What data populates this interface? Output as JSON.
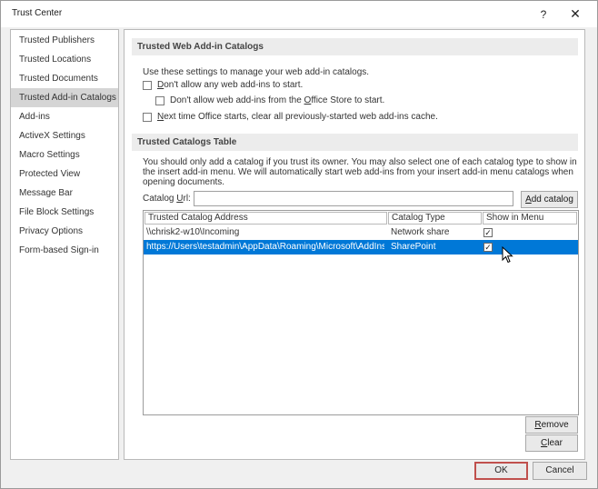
{
  "window": {
    "title": "Trust Center",
    "help_glyph": "?",
    "close_glyph": "✕"
  },
  "sidebar": {
    "items": [
      {
        "label": "Trusted Publishers"
      },
      {
        "label": "Trusted Locations"
      },
      {
        "label": "Trusted Documents"
      },
      {
        "label": "Trusted Add-in Catalogs"
      },
      {
        "label": "Add-ins"
      },
      {
        "label": "ActiveX Settings"
      },
      {
        "label": "Macro Settings"
      },
      {
        "label": "Protected View"
      },
      {
        "label": "Message Bar"
      },
      {
        "label": "File Block Settings"
      },
      {
        "label": "Privacy Options"
      },
      {
        "label": "Form-based Sign-in"
      }
    ],
    "selected_index": 3
  },
  "web_catalogs": {
    "header": "Trusted Web Add-in Catalogs",
    "intro": "Use these settings to manage your web add-in catalogs.",
    "opt1_pre": "",
    "opt1_key": "D",
    "opt1_post": "on't allow any web add-ins to start.",
    "opt2_pre": "Don't allow web add-ins from the ",
    "opt2_key": "O",
    "opt2_post": "ffice Store to start.",
    "opt3_pre": "",
    "opt3_key": "N",
    "opt3_post": "ext time Office starts, clear all previously-started web add-ins cache."
  },
  "catalogs_table": {
    "header": "Trusted Catalogs Table",
    "description": "You should only add a catalog if you trust its owner. You may also select one of each catalog type to show in the insert add-in menu. We will automatically start web add-ins from your insert add-in menu catalogs when opening documents.",
    "url_label_pre": "Catalog ",
    "url_label_key": "U",
    "url_label_post": "rl:",
    "url_value": "",
    "add_pre": "",
    "add_key": "A",
    "add_post": "dd catalog",
    "columns": [
      "Trusted Catalog Address",
      "Catalog Type",
      "Show in Menu"
    ],
    "rows": [
      {
        "address": "\\\\chrisk2-w10\\Incoming",
        "type": "Network share",
        "show": "✓"
      },
      {
        "address": "https://Users\\testadmin\\AppData\\Roaming\\Microsoft\\AddIns",
        "type": "SharePoint",
        "show": "✓"
      }
    ],
    "selected_row": 1,
    "remove_pre": "",
    "remove_key": "R",
    "remove_post": "emove",
    "clear_pre": "",
    "clear_key": "C",
    "clear_post": "lear"
  },
  "footer": {
    "ok": "OK",
    "cancel": "Cancel"
  }
}
